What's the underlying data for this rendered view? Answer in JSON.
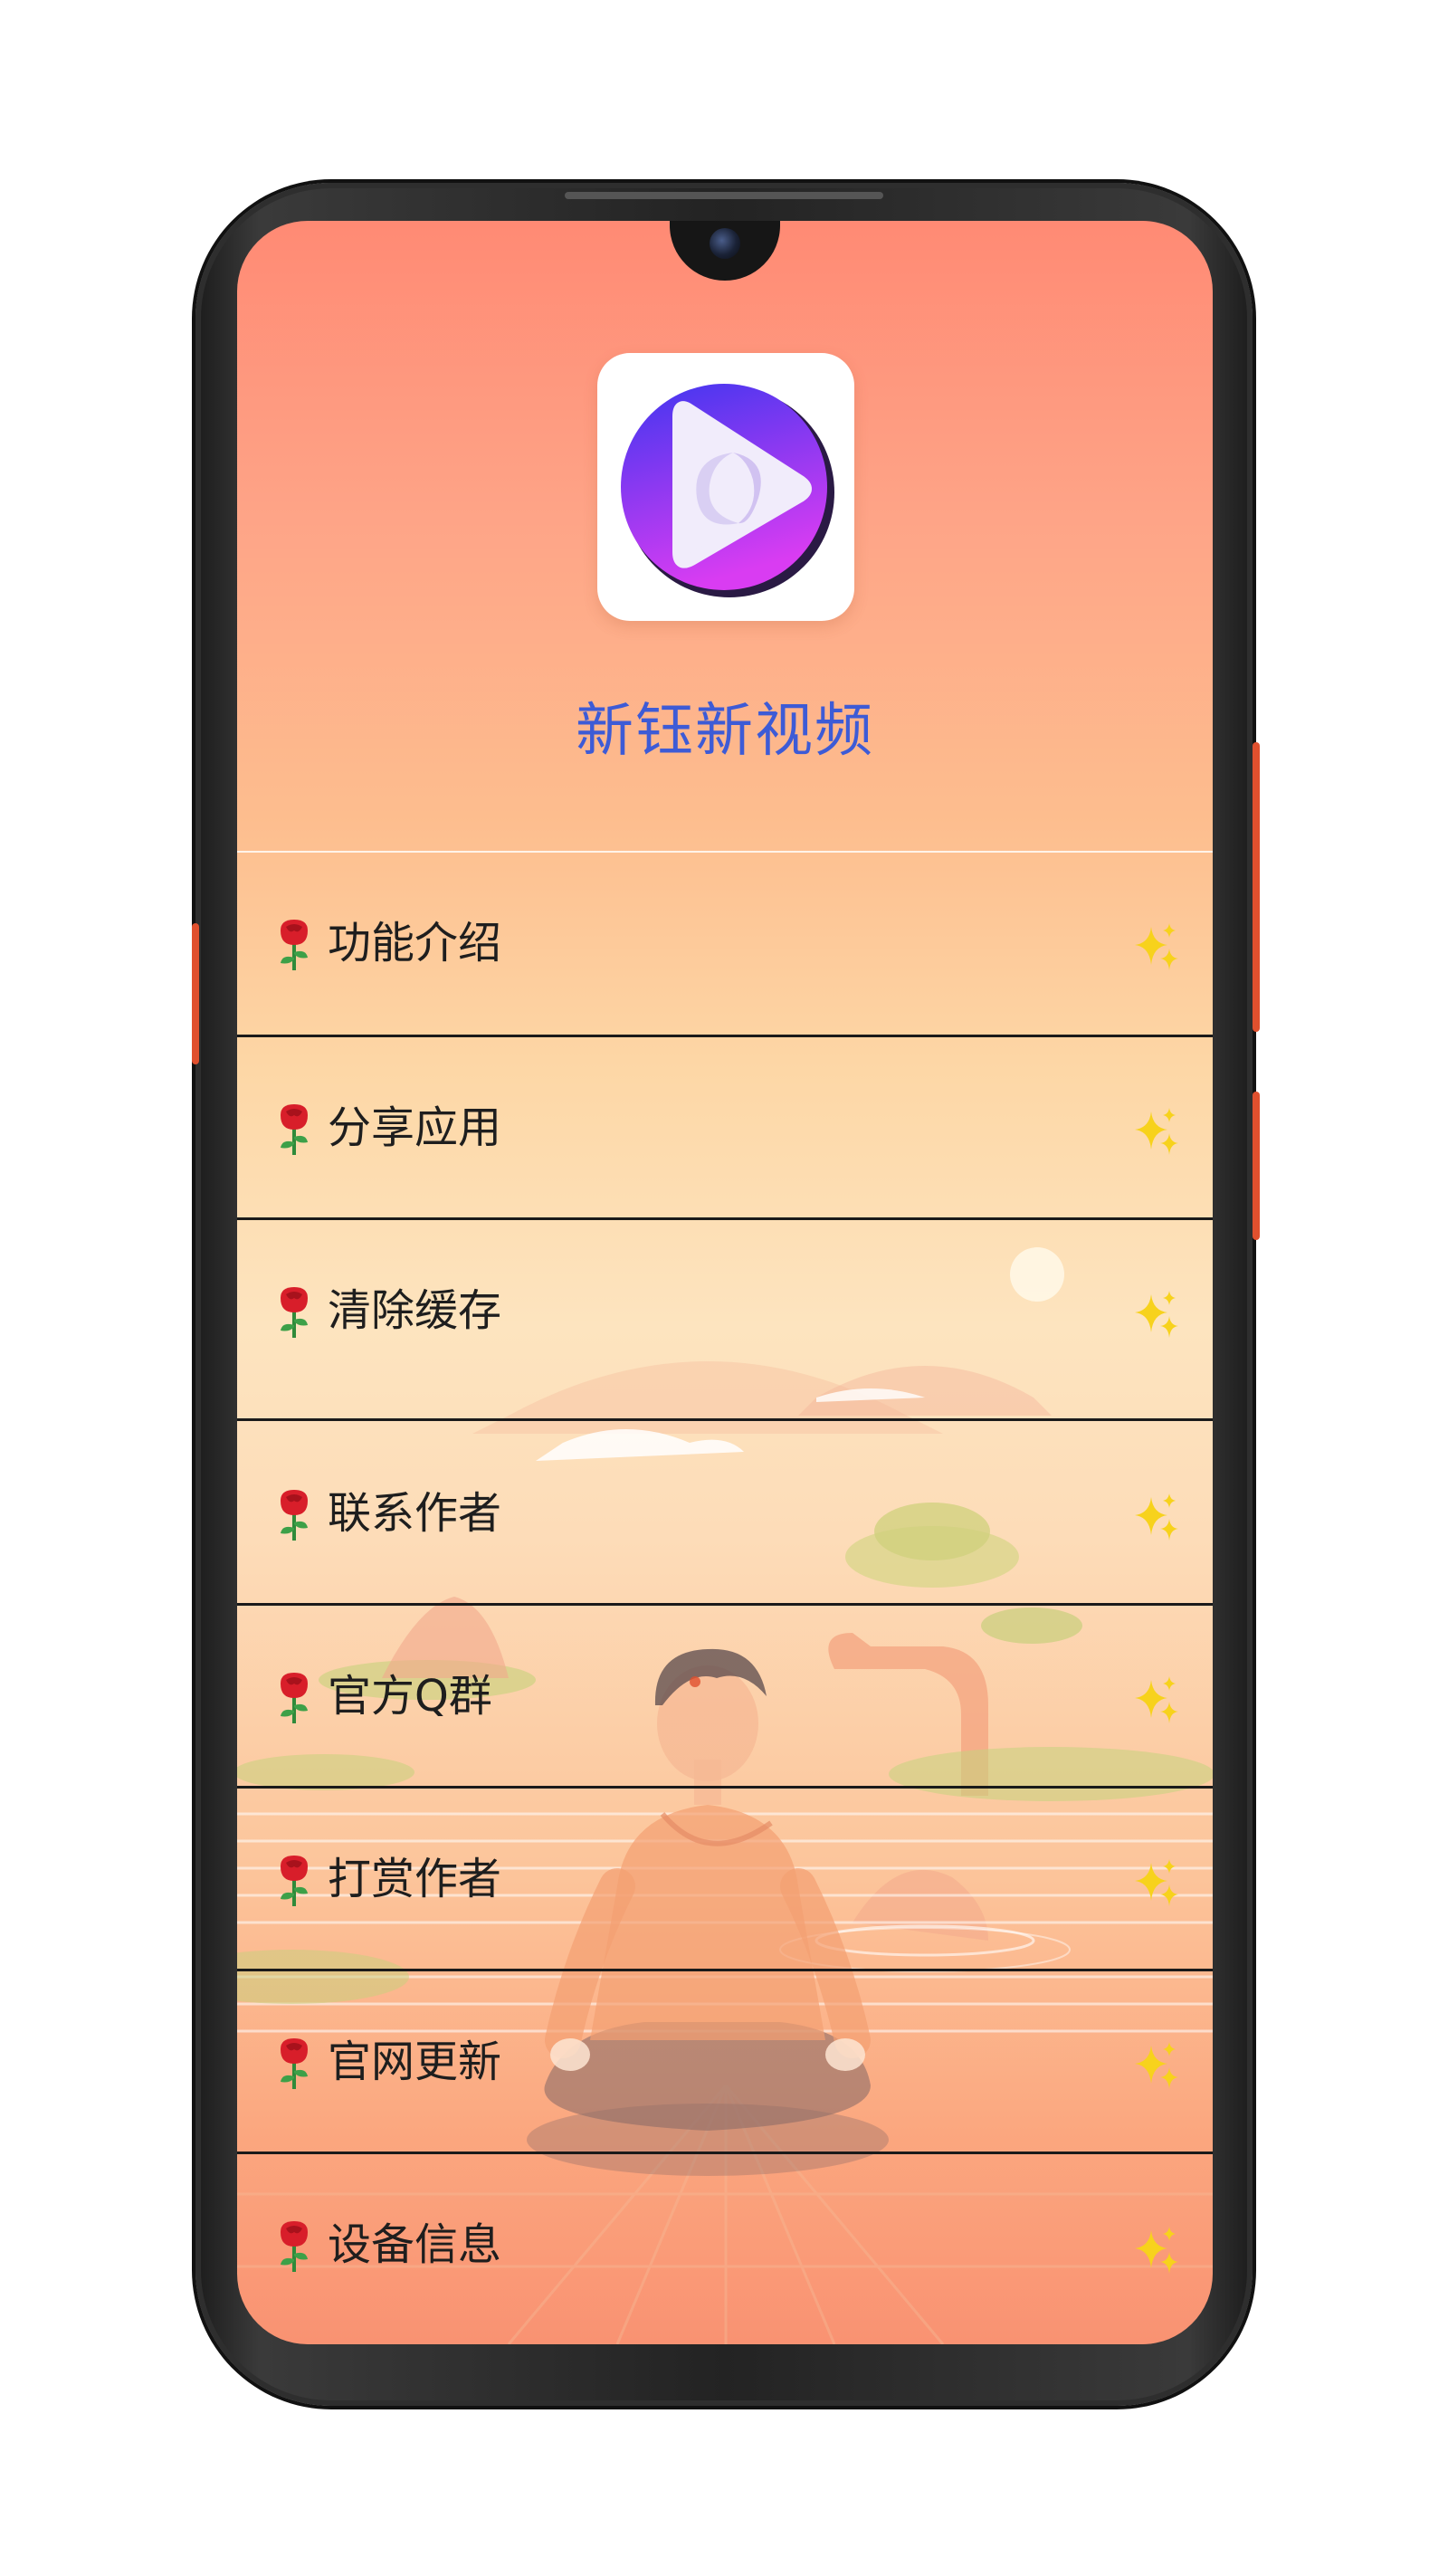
{
  "app": {
    "title": "新钰新视频",
    "icon": "play-button-icon"
  },
  "menu": {
    "items": [
      {
        "label": "功能介绍",
        "icon": "rose-icon",
        "trailing_icon": "sparkles-icon"
      },
      {
        "label": "分享应用",
        "icon": "rose-icon",
        "trailing_icon": "sparkles-icon"
      },
      {
        "label": "清除缓存",
        "icon": "rose-icon",
        "trailing_icon": "sparkles-icon"
      },
      {
        "label": "联系作者",
        "icon": "rose-icon",
        "trailing_icon": "sparkles-icon"
      },
      {
        "label": "官方Q群",
        "icon": "rose-icon",
        "trailing_icon": "sparkles-icon"
      },
      {
        "label": "打赏作者",
        "icon": "rose-icon",
        "trailing_icon": "sparkles-icon"
      },
      {
        "label": "官网更新",
        "icon": "rose-icon",
        "trailing_icon": "sparkles-icon"
      },
      {
        "label": "设备信息",
        "icon": "rose-icon",
        "trailing_icon": "sparkles-icon"
      }
    ]
  },
  "colors": {
    "title": "#3d5bd6",
    "divider": "#1a1a1a",
    "background_top": "#ff8a74",
    "background_mid": "#fde4bf",
    "icon_gradient_start": "#3f36f0",
    "icon_gradient_end": "#d93cf2",
    "sparkle": "#f7d21c",
    "rose": "#d81e2a"
  }
}
